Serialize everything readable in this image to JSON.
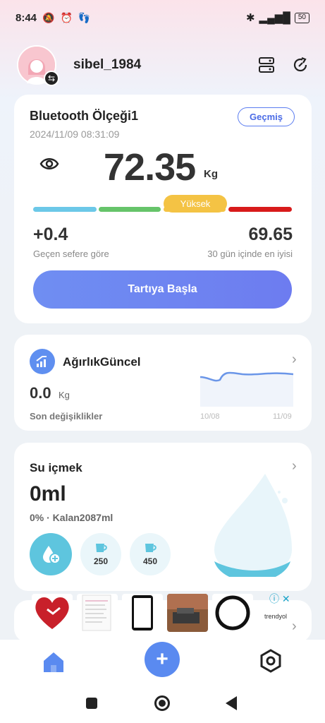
{
  "status": {
    "time": "8:44",
    "battery": "50"
  },
  "header": {
    "username": "sibel_1984"
  },
  "scale": {
    "name": "Bluetooth Ölçeği1",
    "date": "2024/11/09 08:31:09",
    "history_label": "Geçmiş",
    "weight": "72.35",
    "unit": "Kg",
    "level": "Yüksek",
    "diff_value": "+0.4",
    "diff_label": "Geçen sefere göre",
    "best_value": "69.65",
    "best_label": "30 gün içinde en iyisi",
    "start_label": "Tartıya Başla"
  },
  "weight_card": {
    "title": "AğırlıkGüncel",
    "value": "0.0",
    "unit": "Kg",
    "label": "Son değişiklikler",
    "x_from": "10/08",
    "x_to": "11/09"
  },
  "water": {
    "title": "Su içmek",
    "value": "0ml",
    "sub": "0% · Kalan2087ml",
    "cup1": "250",
    "cup2": "450"
  },
  "ad": {
    "brand": "trendyol"
  },
  "colors": {
    "accent": "#5a8af0",
    "high": "#f4c344",
    "water": "#5ec5de"
  },
  "icons": [
    "swap-icon",
    "device-list-icon",
    "refresh-icon",
    "eye-icon",
    "trend-icon",
    "water-drop-icon",
    "cup-icon",
    "home-icon",
    "plus-icon",
    "settings-icon"
  ]
}
